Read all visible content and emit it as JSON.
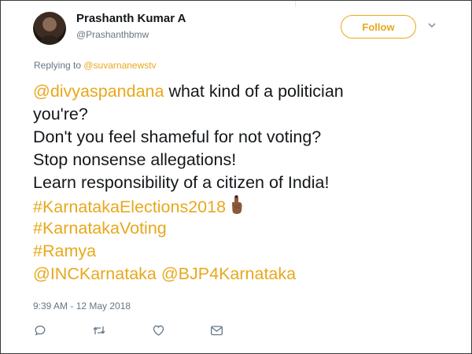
{
  "author": {
    "name": "Prashanth Kumar A",
    "handle": "@Prashanthbmw"
  },
  "follow_label": "Follow",
  "reply_context": {
    "prefix": "Replying to ",
    "handle": "@suvarnanewstv"
  },
  "tweet_lines": [
    [
      {
        "text": "@divyaspandana",
        "link": true
      },
      {
        "text": " what kind of a politician",
        "link": false
      }
    ],
    [
      {
        "text": "you're?",
        "link": false
      }
    ],
    [
      {
        "text": "Don't you feel shameful for not voting?",
        "link": false
      }
    ],
    [
      {
        "text": "Stop nonsense allegations!",
        "link": false
      }
    ],
    [
      {
        "text": "Learn responsibility of a citizen of India!",
        "link": false
      }
    ],
    [
      {
        "text": "#KarnatakaElections2018",
        "link": true
      },
      {
        "emoji": "pointing-finger-icon"
      }
    ],
    [
      {
        "text": "#KarnatakaVoting",
        "link": true
      }
    ],
    [
      {
        "text": "#Ramya",
        "link": true
      }
    ],
    [
      {
        "text": "@INCKarnataka",
        "link": true
      },
      {
        "text": " ",
        "link": false
      },
      {
        "text": "@BJP4Karnataka",
        "link": true
      }
    ]
  ],
  "timestamp": "9:39 AM - 12 May 2018",
  "actions": [
    "reply-icon",
    "retweet-icon",
    "like-icon",
    "message-icon"
  ],
  "colors": {
    "accent": "#e8a81c",
    "text": "#14171a",
    "muted": "#657786"
  }
}
